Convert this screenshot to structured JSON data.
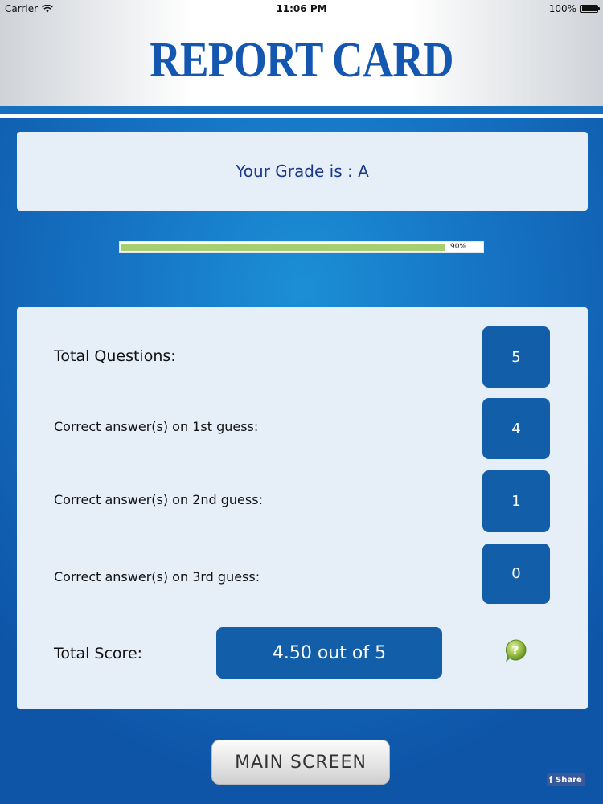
{
  "status_bar": {
    "carrier": "Carrier",
    "time": "11:06 PM",
    "battery": "100%"
  },
  "header": {
    "title": "REPORT CARD"
  },
  "grade": {
    "text": "Your Grade is : A"
  },
  "progress": {
    "label": "90%",
    "value": 90
  },
  "stats": {
    "total_questions_label": "Total Questions:",
    "total_questions_value": "5",
    "first_guess_label": "Correct answer(s) on 1st guess:",
    "first_guess_value": "4",
    "second_guess_label": "Correct answer(s) on 2nd guess:",
    "second_guess_value": "1",
    "third_guess_label": "Correct answer(s) on 3rd guess:",
    "third_guess_value": "0",
    "total_score_label": "Total Score:",
    "total_score_value": "4.50 out of 5"
  },
  "actions": {
    "main_screen_label": "MAIN SCREEN",
    "share_label": "Share",
    "share_icon_glyph": "f"
  },
  "icons": {
    "help": "help-icon",
    "wifi": "wifi-icon",
    "battery": "battery-icon",
    "facebook": "facebook-icon"
  },
  "colors": {
    "accent": "#135ea8",
    "title": "#1457b0",
    "progress_fill": "#a6cf6f"
  }
}
